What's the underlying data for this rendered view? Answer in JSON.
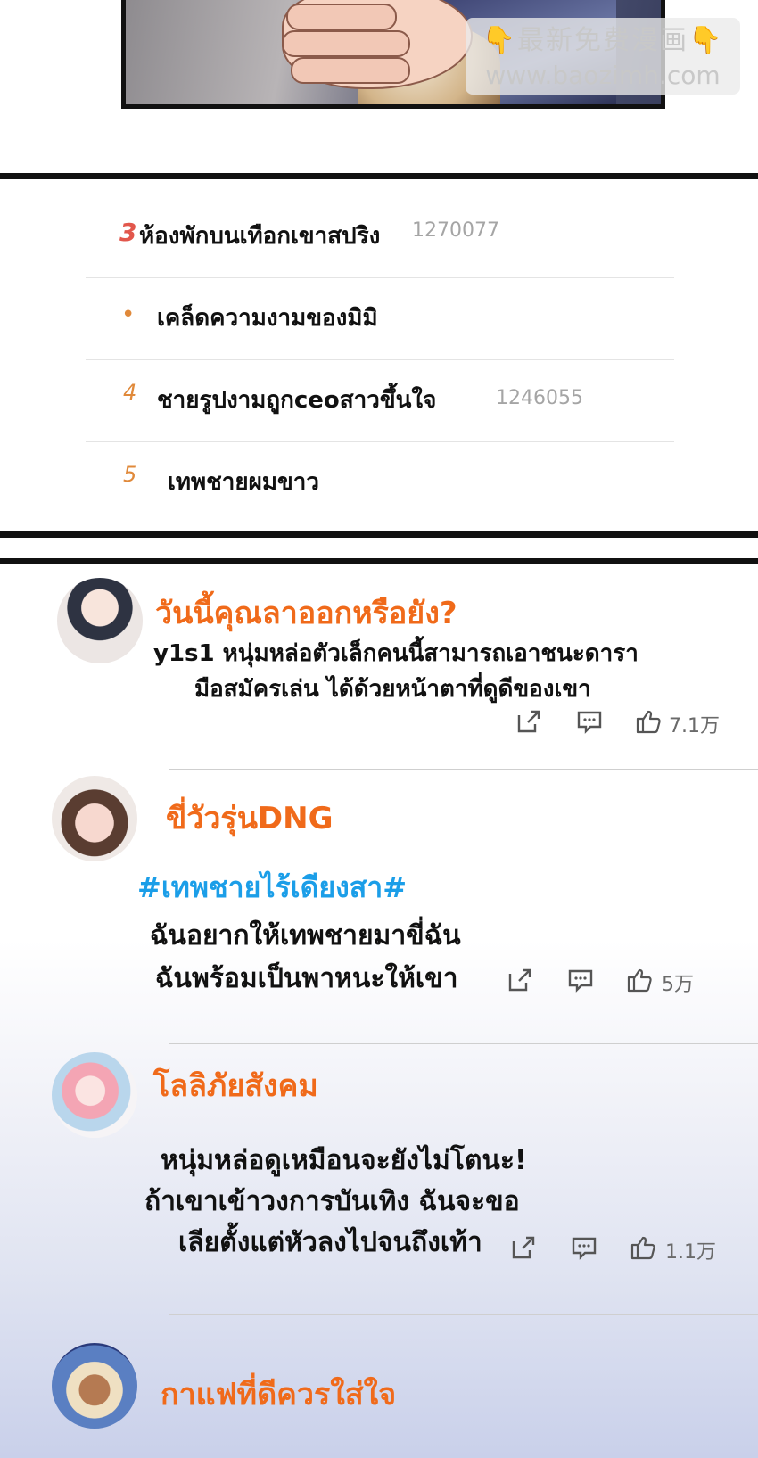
{
  "watermark": {
    "line1": "最新免费漫画",
    "line2": "www.baozimh.com",
    "emoji": "👇"
  },
  "rankings": [
    {
      "rank": "3",
      "title": "ห้องพักบนเทือกเขาสปริง",
      "count": "1270077"
    },
    {
      "rank": "•",
      "title": "เคล็ดความงามของมิมิ",
      "count": ""
    },
    {
      "rank": "4",
      "title": "ชายรูปงามถูกceoสาวขึ้นใจ",
      "count": "1246055"
    },
    {
      "rank": "5",
      "title": "เทพชายผมขาว",
      "count": ""
    }
  ],
  "comments": [
    {
      "username": "วันนี้คุณลาออกหรือยัง?",
      "hashtag": "",
      "lines": [
        "y1s1 หนุ่มหล่อตัวเล็กคนนี้สามารถเอาชนะดารา",
        "มือสมัครเล่น ได้ด้วยหน้าตาที่ดูดีของเขา"
      ],
      "likes": "7.1万"
    },
    {
      "username": "ขี่วัวรุ่นDNG",
      "hashtag": "#เทพชายไร้เดียงสา#",
      "lines": [
        "ฉันอยากให้เทพชายมาขี่ฉัน",
        "ฉันพร้อมเป็นพาหนะให้เขา"
      ],
      "likes": "5万"
    },
    {
      "username": "โลลิภัยสังคม",
      "hashtag": "",
      "lines": [
        "หนุ่มหล่อดูเหมือนจะยังไม่โตนะ!",
        "ถ้าเขาเข้าวงการบันเทิง ฉันจะขอ",
        "เลียตั้งแต่หัวลงไปจนถึงเท้า"
      ],
      "likes": "1.1万"
    },
    {
      "username": "กาแฟที่ดีควรใส่ใจ",
      "hashtag": "",
      "lines": [],
      "likes": ""
    }
  ],
  "icons": {
    "share": "share-icon",
    "comment": "comment-icon",
    "like": "thumbs-up-icon"
  },
  "colors": {
    "username": "#f06a1a",
    "hashtag": "#1b9ee8",
    "rank": "#e0893a",
    "count": "#a5a5a5"
  }
}
